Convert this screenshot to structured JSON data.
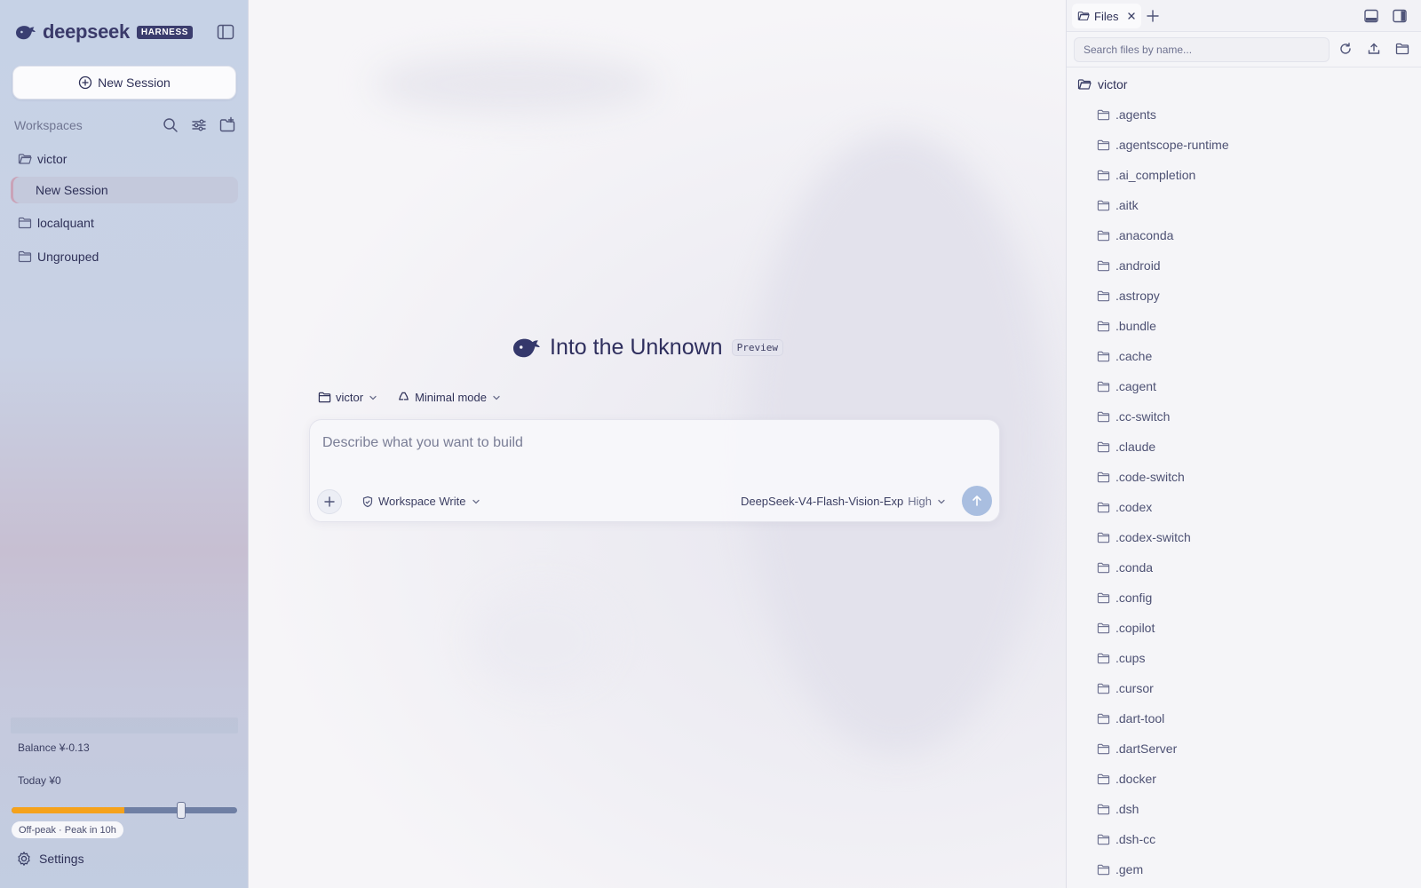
{
  "sidebar": {
    "brand_name": "deepseek",
    "brand_badge": "HARNESS",
    "new_session_label": "New Session",
    "workspaces_label": "Workspaces",
    "tree": [
      {
        "label": "victor",
        "type": "workspace"
      },
      {
        "label": "New Session",
        "type": "session",
        "active": true
      },
      {
        "label": "localquant",
        "type": "workspace"
      },
      {
        "label": "Ungrouped",
        "type": "workspace"
      }
    ],
    "balance_text": "Balance ¥-0.13",
    "today_text": "Today ¥0",
    "usage_fraction": 0.5,
    "usage_marker_fraction": 0.75,
    "peak_text": "Off-peak · Peak in 10h",
    "settings_label": "Settings"
  },
  "main": {
    "title": "Into the Unknown",
    "badge": "Preview",
    "workspace_chip": "victor",
    "mode_chip": "Minimal mode",
    "composer": {
      "placeholder": "Describe what you want to build",
      "value": "",
      "permission_label": "Workspace Write",
      "model_label": "DeepSeek-V4-Flash-Vision-Exp",
      "effort_label": "High"
    }
  },
  "files_panel": {
    "tab_label": "Files",
    "search_placeholder": "Search files by name...",
    "root_folder": "victor",
    "items": [
      ".agents",
      ".agentscope-runtime",
      ".ai_completion",
      ".aitk",
      ".anaconda",
      ".android",
      ".astropy",
      ".bundle",
      ".cache",
      ".cagent",
      ".cc-switch",
      ".claude",
      ".code-switch",
      ".codex",
      ".codex-switch",
      ".conda",
      ".config",
      ".copilot",
      ".cups",
      ".cursor",
      ".dart-tool",
      ".dartServer",
      ".docker",
      ".dsh",
      ".dsh-cc",
      ".gem"
    ]
  },
  "colors": {
    "brand": "#3b3d6e",
    "accent_orange": "#f5a21b",
    "send_button": "#a9bee0",
    "text_primary": "#2f3158"
  }
}
